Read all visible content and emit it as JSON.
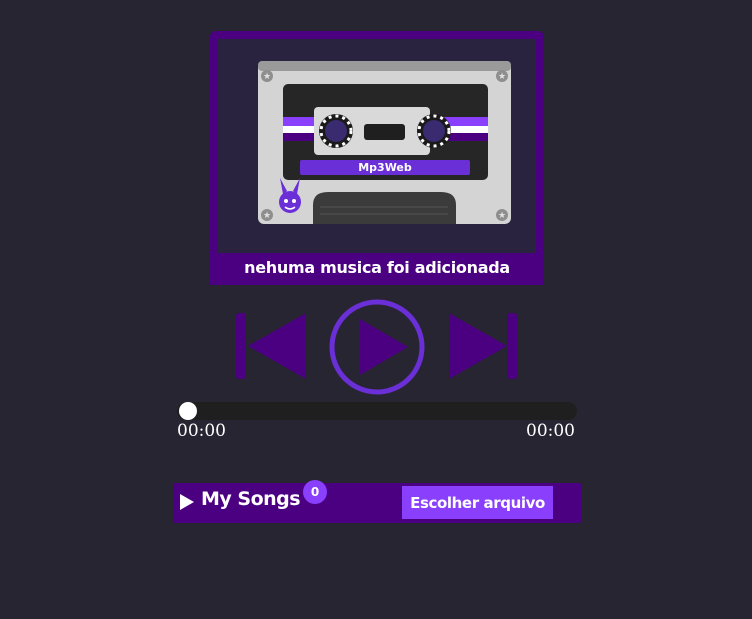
{
  "player": {
    "cassette_label": "Mp3Web",
    "status": "nehuma musica foi adicionada",
    "progress": 0,
    "time_current": "00:00",
    "time_total": "00:00"
  },
  "controls": {
    "prev_icon": "skip-previous-icon",
    "play_icon": "play-icon",
    "next_icon": "skip-next-icon"
  },
  "songs": {
    "title": "My Songs",
    "count": "0",
    "toggle_icon": "triangle-right-icon",
    "choose_file_label": "Escolher arquivo"
  },
  "colors": {
    "background": "#282533",
    "accent": "#4b0082",
    "accent_light": "#8a3ffc",
    "play_ring": "#6a2fd6"
  }
}
